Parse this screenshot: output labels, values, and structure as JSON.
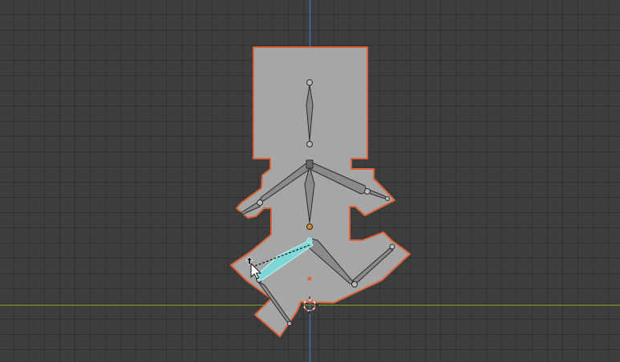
{
  "viewport": {
    "background_color": "#3d3d3d",
    "grid_line_color": "#353535",
    "x_axis_color": "#6e8a2b",
    "y_axis_color": "#3f6e9e"
  },
  "mesh": {
    "fill_color": "#a6a6a6",
    "outline_color": "#e0643a",
    "state": "selected"
  },
  "armature": {
    "bone_color": "#8a8a8a",
    "bone_edge_color": "#2b2b2b",
    "active_bone_color": "#7fd6d6",
    "active_bone_edge_color": "#b7f0f0"
  },
  "icons": {
    "cursor": "mouse-pointer-icon",
    "origin": "object-origin-icon",
    "cursor_3d": "3d-cursor-icon"
  }
}
